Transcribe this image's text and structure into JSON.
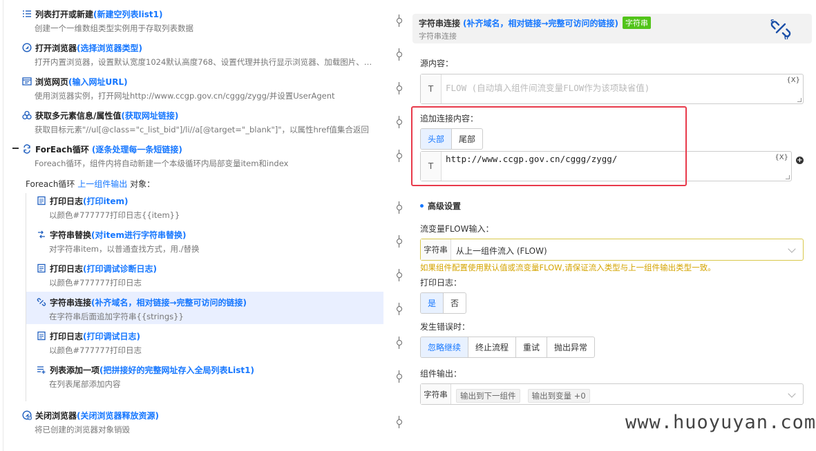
{
  "steps": [
    {
      "name": "列表打开或新建",
      "sub": "(新建空列表list1)",
      "desc": "创建一个一维数组类型实例用于存取列表数据"
    },
    {
      "name": "打开浏览器",
      "sub": "(选择浏览器类型)",
      "desc": "打开内置浏览器，设置默认宽度1024默认高度768、设置代理并执行显示浏览器、加载图片、…"
    },
    {
      "name": "浏览网页",
      "sub": "(输入网址URL)",
      "desc": "使用浏览器实例，打开网址http://www.ccgp.gov.cn/cggg/zygg/并设置UserAgent"
    },
    {
      "name": "获取多元素信息/属性值",
      "sub": "(获取网址链接)",
      "desc": "获取目标元素\"//ul[@class=\"c_list_bid\"]/li//a[@target=\"_blank\"]\"，以属性href值集合返回"
    },
    {
      "name": "ForEach循环",
      "sub": "(逐条处理每一条短链接)",
      "desc": "Foreach循环，组件内将自动新建一个本级循环内局部变量item和index"
    }
  ],
  "foreach": {
    "prefix": "Foreach循环",
    "link": "上一组件输出",
    "suffix": "对象："
  },
  "inner_steps": [
    {
      "name": "打印日志",
      "sub": "(打印item)",
      "desc": "以颜色#777777打印日志{{item}}"
    },
    {
      "name": "字符串替换",
      "sub": "(对item进行字符串替换)",
      "desc": "对字符串item，以普通查找方式，用./替换"
    },
    {
      "name": "打印日志",
      "sub": "(打印调试诊断日志)",
      "desc": "以颜色#777777打印日志"
    },
    {
      "name": "字符串连接",
      "sub": "(补齐域名，相对链接→完整可访问的链接)",
      "desc": "在字符串后面追加字符串{{strings}}"
    },
    {
      "name": "打印日志",
      "sub": "(打印调试日志)",
      "desc": "以颜色#777777打印日志"
    },
    {
      "name": "列表添加一项",
      "sub": "(把拼接好的完整网址存入全局列表List1)",
      "desc": "在列表尾部添加内容"
    }
  ],
  "last_step": {
    "name": "关闭浏览器",
    "sub": "(关闭浏览器释放资源)",
    "desc": "将已创建的浏览器对象销毁"
  },
  "panel": {
    "title": "字符串连接",
    "sub": "(补齐域名，相对链接→完整可访问的链接)",
    "tag": "字符串",
    "subtitle": "字符串连接",
    "source_label": "源内容：",
    "source_t": "T",
    "source_placeholder": "FLOW (自动填入组件间流变量FLOW作为该项缺省值)",
    "var_token": "{X}",
    "append_label": "追加连接内容：",
    "pos_head": "头部",
    "pos_tail": "尾部",
    "append_t": "T",
    "append_value": "http://www.ccgp.gov.cn/cggg/zygg/",
    "plus": "+",
    "advanced": "高级设置",
    "flow_label": "流变量FLOW输入：",
    "flow_type": "字符串",
    "flow_value": "从上一组件流入 (FLOW)",
    "warning": "如果组件配置使用默认值或流变量FLOW,请保证流入类型与上一组件输出类型一致。",
    "log_label": "打印日志：",
    "log_yes": "是",
    "log_no": "否",
    "error_label": "发生错误时：",
    "err_ignore": "忽略继续",
    "err_stop": "终止流程",
    "err_retry": "重试",
    "err_throw": "抛出异常",
    "output_label": "组件输出：",
    "output_type": "字符串",
    "output_chip1": "输出到下一组件",
    "output_chip2": "输出到变量 +0"
  },
  "watermark": "www.huoyuyan.com",
  "colors": {
    "accent": "#1677ff",
    "tag_green": "#52c41a",
    "highlight_red": "#e8394a",
    "warning": "#d4a400",
    "selected_row": "#e9efff"
  },
  "icons": [
    "list-icon",
    "browser-icon",
    "webpage-icon",
    "multi-element-icon",
    "loop-icon",
    "log-icon",
    "replace-icon",
    "string-join-icon",
    "list-add-icon",
    "close-browser-icon"
  ]
}
